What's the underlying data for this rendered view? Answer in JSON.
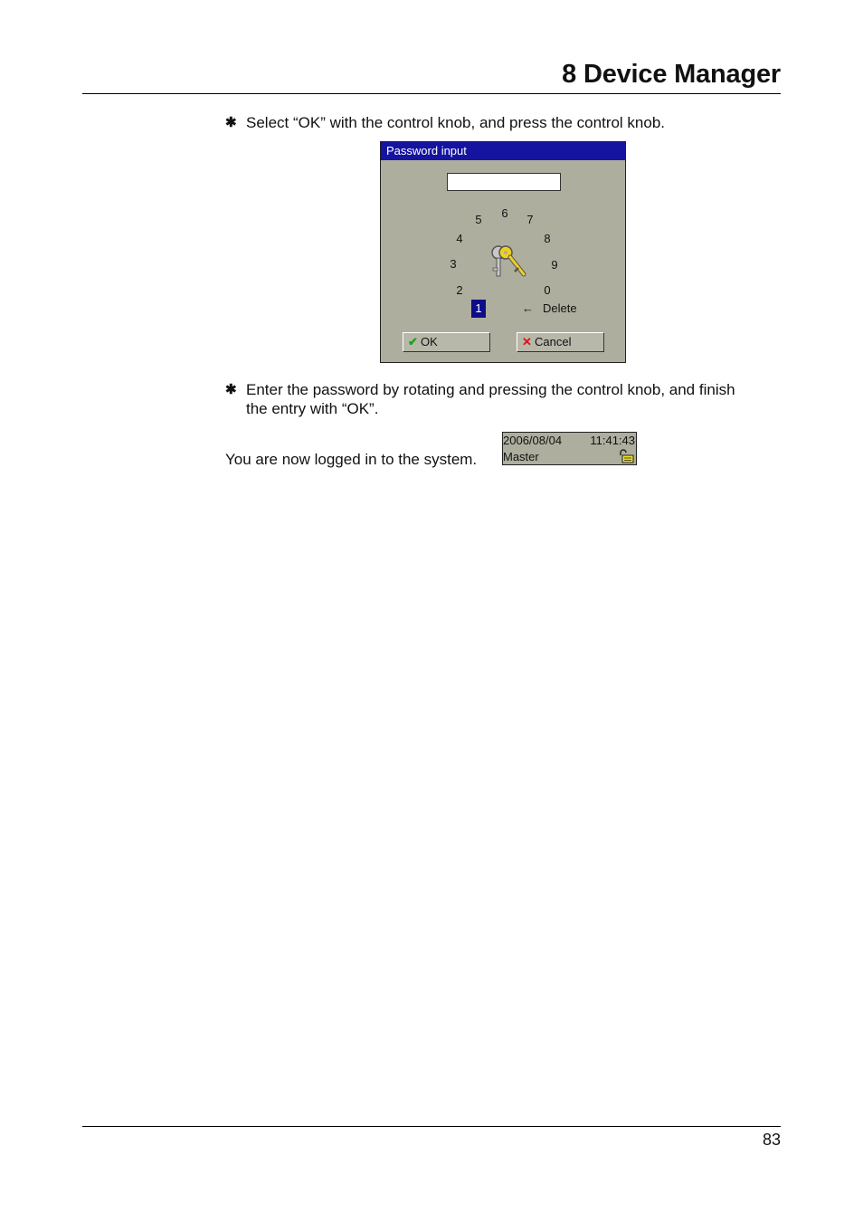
{
  "header": {
    "chapter_title": "8 Device Manager"
  },
  "steps": [
    {
      "bullet": "✱",
      "text": "Select “OK” with the control knob, and press the control knob."
    },
    {
      "bullet": "✱",
      "text_line1": "Enter the password by rotating and pressing the control knob, and finish",
      "text_line2": "the entry with “OK”."
    }
  ],
  "dialog": {
    "title": "Password input",
    "input_value": "",
    "digits": [
      "0",
      "1",
      "2",
      "3",
      "4",
      "5",
      "6",
      "7",
      "8",
      "9"
    ],
    "selected_digit": "1",
    "delete_arrow": "←",
    "delete_label": "Delete",
    "ok_label": "OK",
    "cancel_label": "Cancel",
    "colors": {
      "title_bar": "#1414a0",
      "body": "#aeae9f",
      "selected": "#0d0d8a"
    },
    "icons": {
      "center": "key-icon",
      "ok": "checkmark-icon",
      "cancel": "x-icon"
    }
  },
  "logged_in": {
    "text": "You are now logged in to the system.",
    "status": {
      "date": "2006/08/04",
      "time": "11:41:43",
      "user": "Master",
      "icon": "unlocked-padlock-icon"
    }
  },
  "footer": {
    "page_number": "83"
  }
}
